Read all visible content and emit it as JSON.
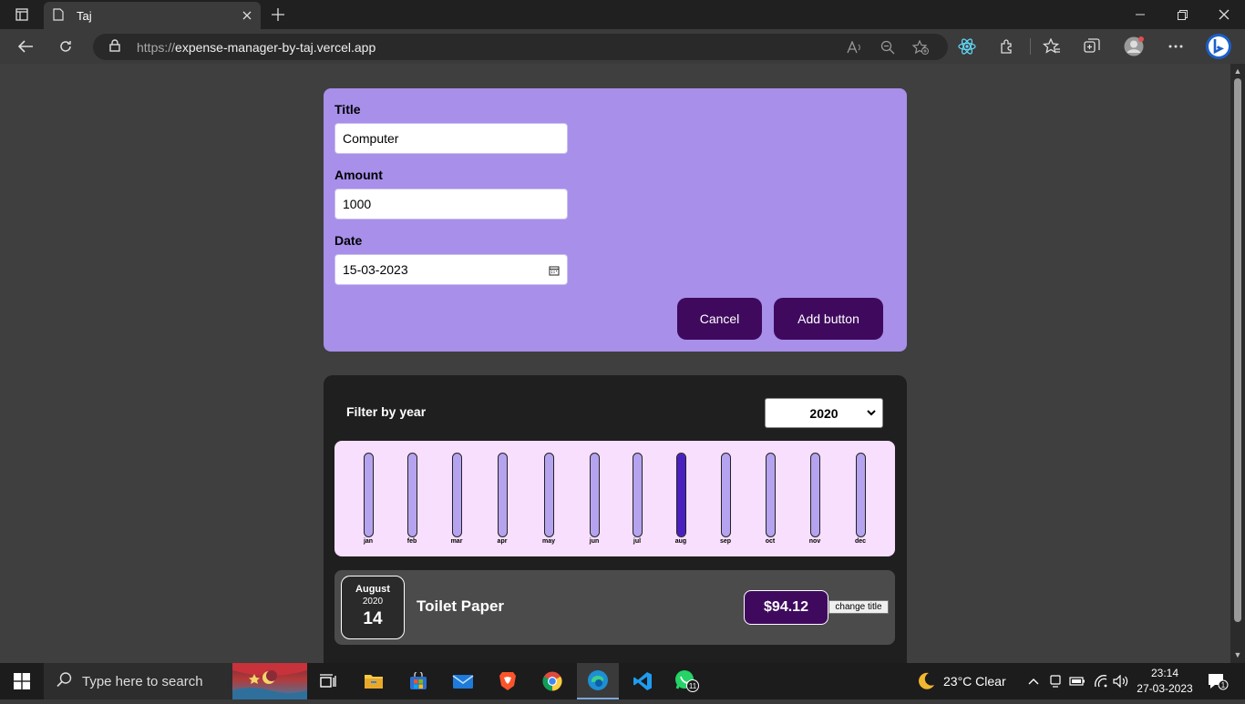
{
  "browser": {
    "tab_title": "Taj",
    "url_scheme": "https://",
    "url_host": "expense-manager-by-taj.vercel.app"
  },
  "form": {
    "title_label": "Title",
    "title_value": "Computer",
    "amount_label": "Amount",
    "amount_value": "1000",
    "date_label": "Date",
    "date_value": "15-03-2023",
    "cancel_label": "Cancel",
    "add_label": "Add button"
  },
  "expenses": {
    "filter_label": "Filter by year",
    "selected_year": "2020",
    "chart_data": {
      "type": "bar",
      "categories": [
        "jan",
        "feb",
        "mar",
        "apr",
        "may",
        "jun",
        "jul",
        "aug",
        "sep",
        "oct",
        "nov",
        "dec"
      ],
      "values": [
        0,
        0,
        0,
        0,
        0,
        0,
        0,
        94.12,
        0,
        0,
        0,
        0
      ],
      "max": 94.12
    },
    "items": [
      {
        "month": "August",
        "year": "2020",
        "day": "14",
        "title": "Toilet Paper",
        "amount": "$94.12",
        "change_label": "change title"
      }
    ]
  },
  "taskbar": {
    "search_placeholder": "Type here to search",
    "weather": "23°C  Clear",
    "time": "23:14",
    "date": "27-03-2023",
    "whatsapp_badge": "11",
    "notification_badge": "1"
  },
  "colors": {
    "form_bg": "#a78fea",
    "button_bg": "#3f0a5e",
    "chart_bg": "#f8dffe",
    "bar_empty": "#b5a3ef",
    "bar_fill": "#4a1fbf"
  }
}
